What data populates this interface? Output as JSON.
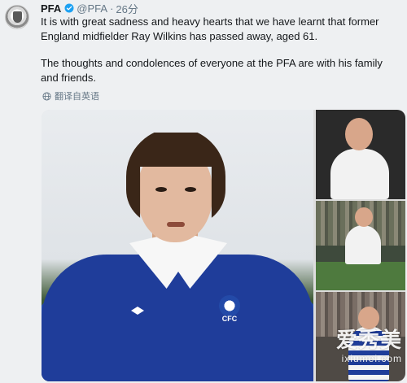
{
  "tweet": {
    "author": {
      "name": "PFA",
      "handle": "@PFA",
      "separator": "·",
      "timestamp": "26分",
      "verified": true
    },
    "paragraphs": [
      "It is with great sadness and heavy hearts that we have learnt that former England midfielder Ray Wilkins has passed away, aged 61.",
      "The thoughts and condolences of everyone at the PFA are with his family and friends."
    ],
    "translate_label": "翻译自英语",
    "media": {
      "main_photo_badge": "CFC",
      "side_photos": 3
    }
  },
  "watermark": {
    "main": "爱秀美",
    "sub": "ixiumei.com"
  },
  "colors": {
    "background": "#eef0f2",
    "text": "#14171a",
    "muted": "#657786",
    "verified_blue": "#1da1f2"
  },
  "icons": {
    "verified": "verified-badge-icon",
    "translate": "globe-icon"
  }
}
